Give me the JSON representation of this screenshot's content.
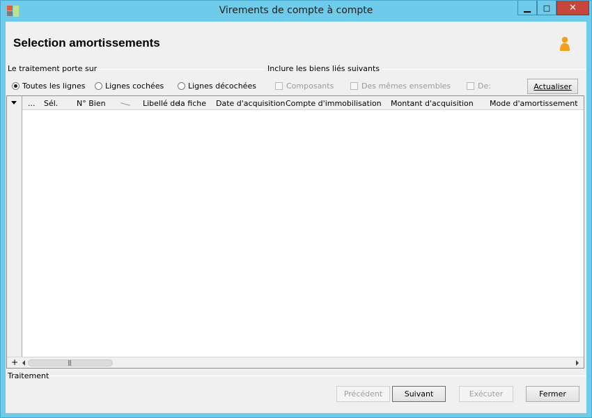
{
  "window": {
    "title": "Virements de compte à compte",
    "minimize_glyph": "▁",
    "maximize_glyph": "□",
    "close_glyph": "✕",
    "icon_colors": [
      "#e35d3c",
      "#bfe28a",
      "#7c7c7c",
      "#f7e67a"
    ]
  },
  "header": {
    "title": "Selection amortissements",
    "user_icon": "user-icon",
    "user_icon_color": "#f2a01c"
  },
  "scope": {
    "label": "Le traitement porte sur",
    "options": [
      {
        "label": "Toutes les lignes",
        "selected": true
      },
      {
        "label": "Lignes cochées",
        "selected": false
      },
      {
        "label": "Lignes décochées",
        "selected": false
      }
    ]
  },
  "include": {
    "label": "Inclure les biens liés suivants",
    "options": [
      {
        "label": "Composants",
        "checked": false,
        "enabled": false
      },
      {
        "label": "Des mêmes ensembles",
        "checked": false,
        "enabled": false
      },
      {
        "label": "De:",
        "checked": false,
        "enabled": false
      }
    ]
  },
  "refresh_button": "Actualiser",
  "grid": {
    "columns": [
      "...",
      "Sél.",
      "N° Bien",
      "Libellé de",
      "la fiche",
      "Date d'acquisition",
      "Compte d'immobilisation",
      "Montant d'acquisition",
      "Mode d'amortissement"
    ],
    "add_glyph": "+",
    "grip_glyph": "|||"
  },
  "footer": {
    "label": "Traitement",
    "buttons": [
      {
        "label": "Précédent",
        "enabled": false
      },
      {
        "label": "Suivant",
        "enabled": true,
        "focused": true
      },
      {
        "label": "Exécuter",
        "enabled": false
      },
      {
        "label": "Fermer",
        "enabled": true
      }
    ]
  }
}
